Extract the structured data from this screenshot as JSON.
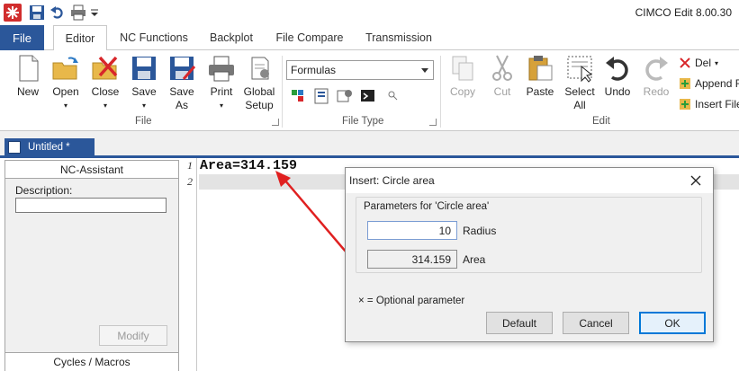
{
  "app": {
    "title": "CIMCO Edit 8.00.30"
  },
  "tabs": {
    "file": "File",
    "items": [
      "Editor",
      "NC Functions",
      "Backplot",
      "File Compare",
      "Transmission"
    ]
  },
  "ribbon": {
    "file_group": {
      "label": "File",
      "buttons": {
        "new": "New",
        "open": "Open",
        "close": "Close",
        "save": "Save",
        "save_as_1": "Save",
        "save_as_2": "As",
        "print": "Print",
        "global_setup_1": "Global",
        "global_setup_2": "Setup"
      }
    },
    "filetype_group": {
      "label": "File Type",
      "combo_value": "Formulas"
    },
    "edit_group": {
      "label": "Edit",
      "buttons": {
        "copy": "Copy",
        "cut": "Cut",
        "paste": "Paste",
        "select_all_1": "Select",
        "select_all_2": "All",
        "undo": "Undo",
        "redo": "Redo"
      }
    },
    "side_cmds": {
      "del": "Del",
      "append": "Append F",
      "insert_file": "Insert File"
    }
  },
  "doc_tab": {
    "label": "Untitled *"
  },
  "nc_assistant": {
    "header": "NC-Assistant",
    "description_label": "Description:",
    "description_value": "",
    "modify": "Modify",
    "footer": "Cycles / Macros"
  },
  "editor": {
    "lines": [
      {
        "num": "1",
        "text": "Area=314.159"
      },
      {
        "num": "2",
        "text": ""
      }
    ]
  },
  "dialog": {
    "title": "Insert: Circle area",
    "legend": "Parameters for 'Circle area'",
    "params": [
      {
        "value": "10",
        "label": "Radius"
      },
      {
        "value": "314.159",
        "label": "Area"
      }
    ],
    "optional_note": "×  =  Optional parameter",
    "buttons": {
      "default": "Default",
      "cancel": "Cancel",
      "ok": "OK"
    }
  },
  "colors": {
    "accent": "#2b579a",
    "annotation_arrow": "#e02020",
    "ok_border": "#0078d7"
  }
}
